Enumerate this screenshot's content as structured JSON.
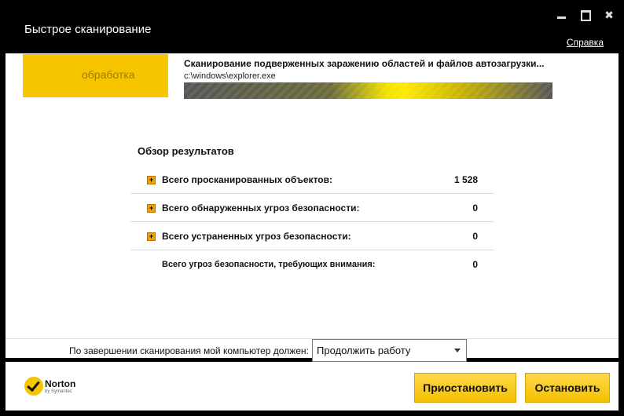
{
  "window": {
    "title": "Быстрое сканирование",
    "help_label": "Справка",
    "controls": {
      "minimize": "minimize-icon",
      "maximize": "maximize-icon",
      "close": "close-icon"
    }
  },
  "brand": {
    "overlay_text": "обработка"
  },
  "scan": {
    "status": "Сканирование подверженных заражению областей и файлов автозагрузки...",
    "current_file": "c:\\windows\\explorer.exe",
    "progress_color": "#ffe800"
  },
  "results": {
    "title": "Обзор результатов",
    "rows": [
      {
        "label": "Всего просканированных объектов:",
        "value": "1 528"
      },
      {
        "label": "Всего обнаруженных угроз безопасности:",
        "value": "0"
      },
      {
        "label": "Всего устраненных угроз безопасности:",
        "value": "0"
      },
      {
        "label": "Всего угроз безопасности, требующих внимания:",
        "value": "0"
      }
    ]
  },
  "after_scan": {
    "label": "По завершении сканирования мой компьютер должен:",
    "selected": "Продолжить работу"
  },
  "footer": {
    "logo_name": "Norton",
    "logo_sub": "by Symantec",
    "pause_label": "Приостановить",
    "stop_label": "Остановить"
  },
  "colors": {
    "accent": "#f6c500",
    "titlebar": "#000000",
    "expander": "#f4a000"
  }
}
